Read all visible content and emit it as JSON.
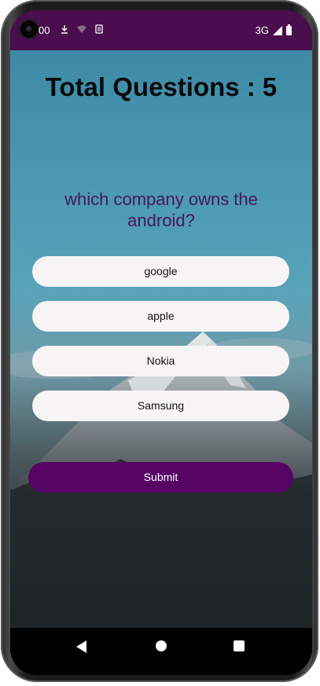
{
  "status_bar": {
    "time": "00",
    "network": "3G",
    "left_icons": [
      "download-icon",
      "wifi-icon",
      "sim-icon"
    ],
    "background": "#4a0d4e"
  },
  "quiz": {
    "title": "Total Questions : 5",
    "question": "which company owns the android?",
    "options": [
      {
        "label": "google"
      },
      {
        "label": "apple"
      },
      {
        "label": "Nokia"
      },
      {
        "label": "Samsung"
      }
    ],
    "submit_label": "Submit",
    "accent_color": "#560466",
    "question_color": "#4a1560"
  },
  "nav_bar": {
    "icons": [
      "back-icon",
      "home-icon",
      "recents-icon"
    ]
  }
}
